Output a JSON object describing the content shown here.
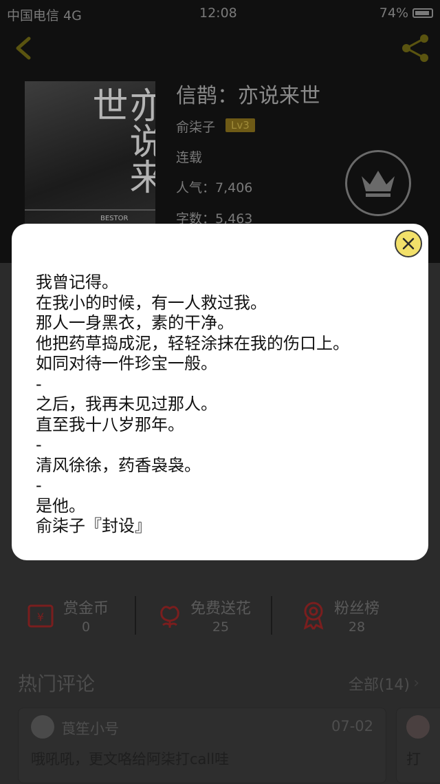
{
  "status_bar": {
    "carrier": "中国电信  4G",
    "time": "12:08",
    "battery": "74%"
  },
  "book": {
    "title": "信鹊：亦说来世",
    "author": "俞柒子",
    "level_badge": "Lv3",
    "status": "连载",
    "popularity": "人气：7,406",
    "word_count": "字数：5,463",
    "cover_calligraphy": "亦说来世",
    "cover_small_text": "BESTOR"
  },
  "stats": [
    {
      "label": "赏金币",
      "value": "0",
      "icon": "red-envelope-icon"
    },
    {
      "label": "免费送花",
      "value": "25",
      "icon": "flower-icon"
    },
    {
      "label": "粉丝榜",
      "value": "28",
      "icon": "medal-icon"
    }
  ],
  "comments": {
    "title": "热门评论",
    "all_label": "全部(14)",
    "items": [
      {
        "user": "莨笙小号",
        "date": "07-02",
        "text": "哦吼吼，更文咯给阿柒打call哇"
      },
      {
        "user": "",
        "date": "",
        "text": "打"
      }
    ]
  },
  "modal": {
    "synopsis_lines": [
      "我曾记得。",
      "在我小的时候，有一人救过我。",
      "那人一身黑衣，素的干净。",
      "他把药草捣成泥，轻轻涂抹在我的伤口上。",
      "如同对待一件珍宝一般。",
      "-",
      "之后，我再未见过那人。",
      "直至我十八岁那年。",
      "-",
      "清风徐徐，药香袅袅。",
      "-",
      "是他。",
      "俞柒子『封设』"
    ]
  },
  "colors": {
    "accent_yellow": "#f2e06a",
    "badge_gold": "#6e5a16",
    "stat_icon_red": "#7a1e1e"
  }
}
